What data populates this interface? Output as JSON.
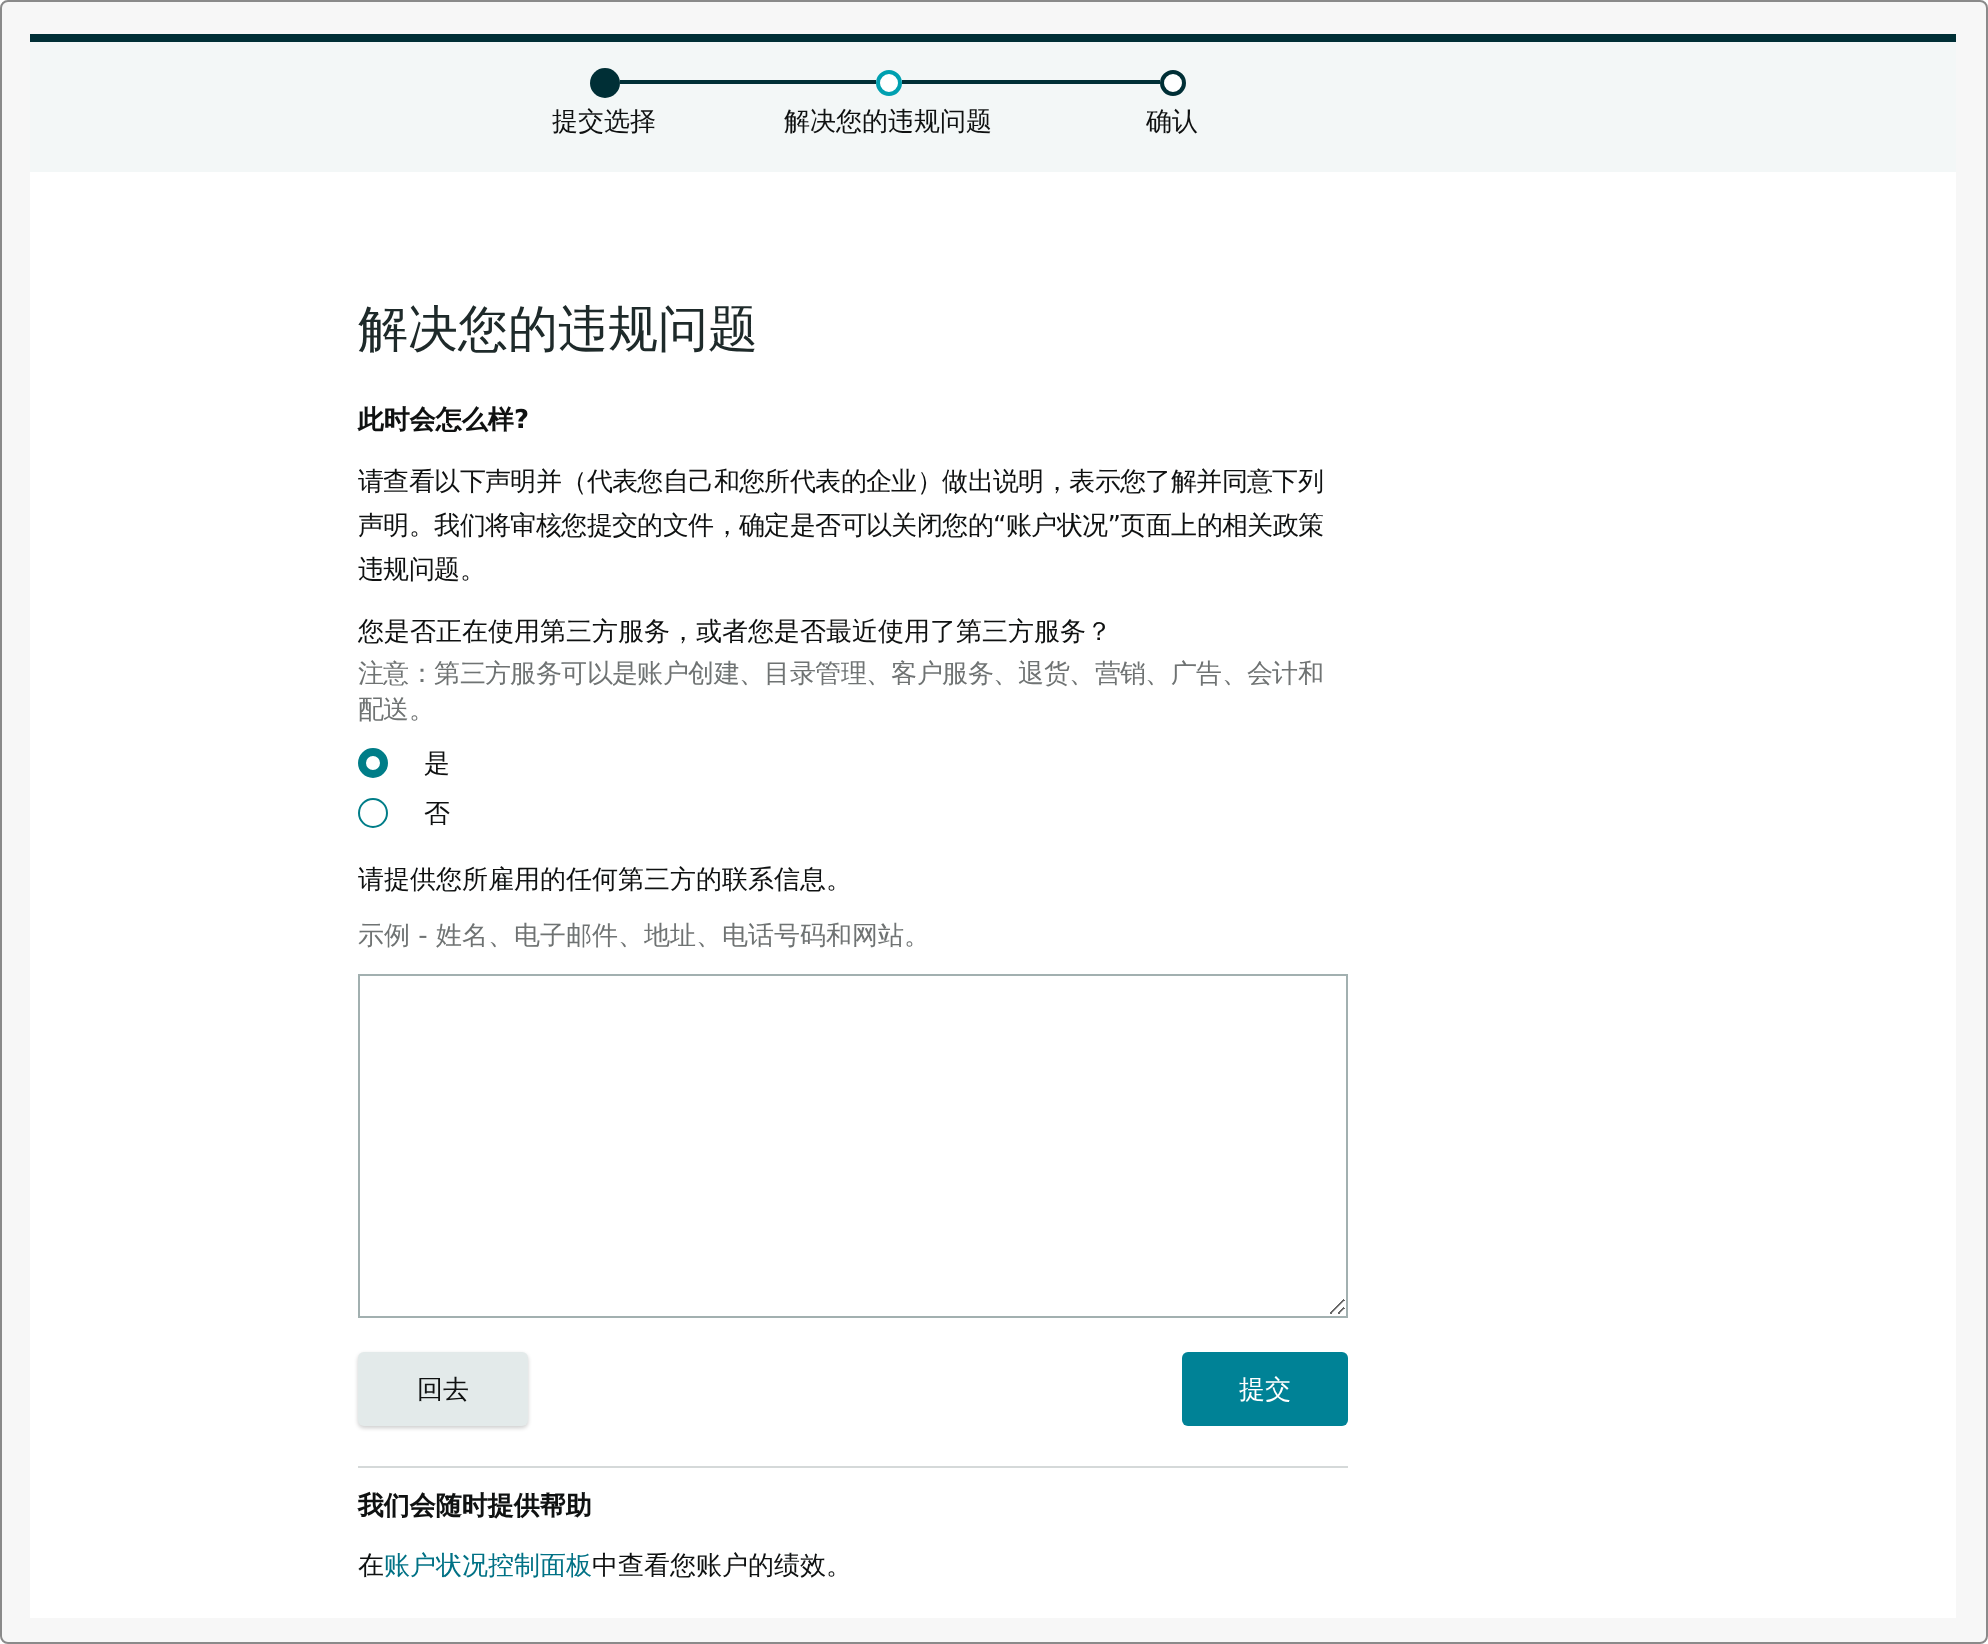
{
  "steps": [
    {
      "label": "提交选择",
      "kind": "done"
    },
    {
      "label": "解决您的违规问题",
      "kind": "current"
    },
    {
      "label": "确认",
      "kind": "pending"
    }
  ],
  "title": "解决您的违规问题",
  "what_heading": "此时会怎么样?",
  "statement": "请查看以下声明并（代表您自己和您所代表的企业）做出说明，表示您了解并同意下列声明。我们将审核您提交的文件，确定是否可以关闭您的“账户状况”页面上的相关政策违规问题。",
  "question": "您是否正在使用第三方服务，或者您是否最近使用了第三方服务？",
  "note": "注意：第三方服务可以是账户创建、目录管理、客户服务、退货、营销、广告、会计和配送。",
  "options": [
    {
      "label": "是",
      "selected": true
    },
    {
      "label": "否",
      "selected": false
    }
  ],
  "contact_label": "请提供您所雇用的任何第三方的联系信息。",
  "contact_hint": "示例 - 姓名、电子邮件、地址、电话号码和网站。",
  "buttons": {
    "back": "回去",
    "submit": "提交"
  },
  "help": {
    "heading": "我们会随时提供帮助",
    "prefix": "在",
    "link": "账户状况控制面板",
    "suffix": "中查看您账户的绩效。"
  }
}
